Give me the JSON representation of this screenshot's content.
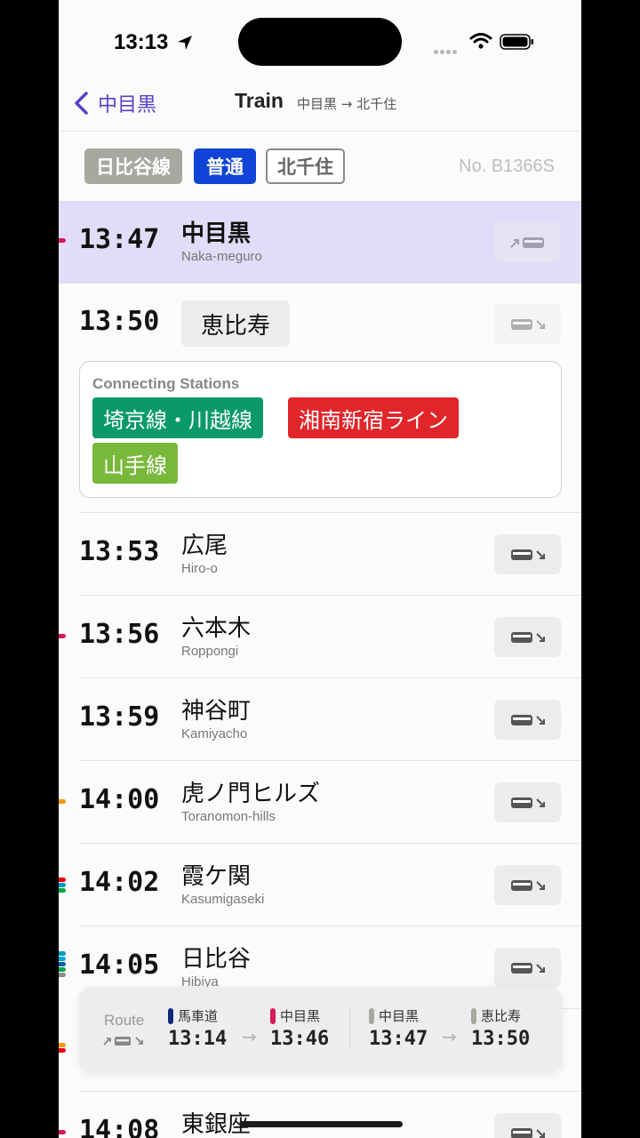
{
  "status": {
    "time": "13:13"
  },
  "nav": {
    "back_label": "中目黒",
    "title": "Train",
    "subtitle": "中目黒 → 北千住"
  },
  "train": {
    "line": "日比谷線",
    "type": "普通",
    "destination": "北千住",
    "number": "No. B1366S"
  },
  "colors": {
    "accent": "#5a3fc8",
    "current_row": "#e2dcf8",
    "type_badge": "#1044d6",
    "line_badge": "#a8a8a0"
  },
  "stops": [
    {
      "time": "13:47",
      "jp": "中目黒",
      "en": "Naka-meguro"
    },
    {
      "time": "13:50",
      "jp": "恵比寿",
      "en": ""
    },
    {
      "time": "13:53",
      "jp": "広尾",
      "en": "Hiro-o"
    },
    {
      "time": "13:56",
      "jp": "六本木",
      "en": "Roppongi"
    },
    {
      "time": "13:59",
      "jp": "神谷町",
      "en": "Kamiyacho"
    },
    {
      "time": "14:00",
      "jp": "虎ノ門ヒルズ",
      "en": "Toranomon-hills"
    },
    {
      "time": "14:02",
      "jp": "霞ケ関",
      "en": "Kasumigaseki"
    },
    {
      "time": "14:05",
      "jp": "日比谷",
      "en": "Hibiya"
    },
    {
      "time": "14:08",
      "jp": "東銀座",
      "en": ""
    }
  ],
  "connecting": {
    "title": "Connecting Stations",
    "lines": [
      {
        "name": "埼京線・川越線",
        "color": "#0a9a6a"
      },
      {
        "name": "湘南新宿ライン",
        "color": "#e0262a"
      },
      {
        "name": "山手線",
        "color": "#78b83a"
      }
    ]
  },
  "route": {
    "label": "Route",
    "segments": [
      {
        "from": "馬車道",
        "from_time": "13:14",
        "from_color": "#0b2a7a",
        "to": "中目黒",
        "to_time": "13:46",
        "to_color": "#d6195a"
      },
      {
        "from": "中目黒",
        "from_time": "13:47",
        "from_color": "#a8a8a0",
        "to": "恵比寿",
        "to_time": "13:50",
        "to_color": "#a8a8a0"
      }
    ]
  }
}
